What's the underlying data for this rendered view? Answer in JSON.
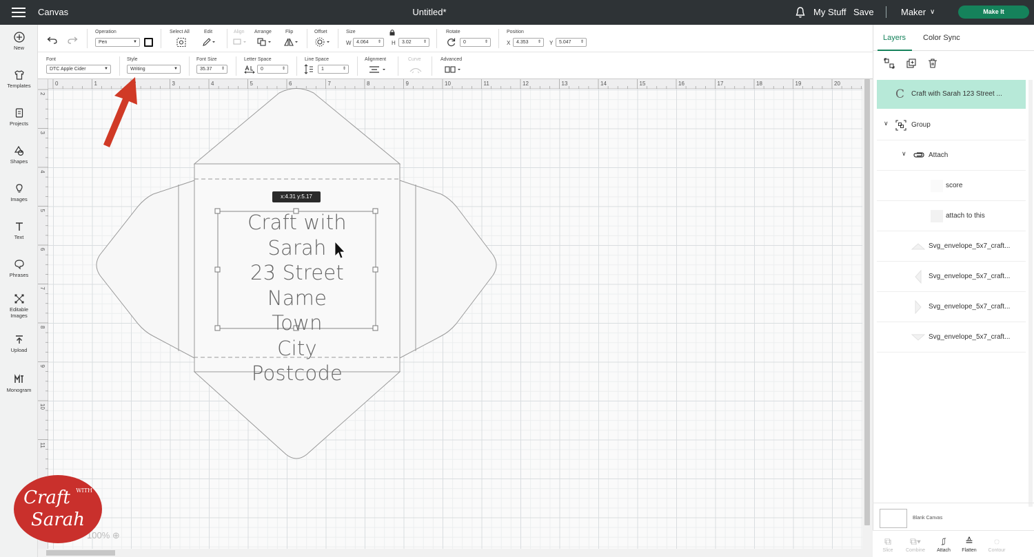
{
  "app": {
    "name": "Canvas",
    "doc_title": "Untitled*",
    "my_stuff": "My Stuff",
    "save": "Save",
    "machine": "Maker",
    "make_it": "Make It"
  },
  "sidebar": {
    "items": [
      {
        "label": "New",
        "icon": "plus-circle-icon"
      },
      {
        "label": "Templates",
        "icon": "shirt-icon"
      },
      {
        "label": "Projects",
        "icon": "projects-icon"
      },
      {
        "label": "Shapes",
        "icon": "shapes-icon"
      },
      {
        "label": "Images",
        "icon": "lightbulb-icon"
      },
      {
        "label": "Text",
        "icon": "text-T-icon"
      },
      {
        "label": "Phrases",
        "icon": "speech-bubble-icon"
      },
      {
        "label": "Editable",
        "label2": "Images",
        "icon": "editable-images-icon"
      },
      {
        "label": "Upload",
        "icon": "upload-icon"
      },
      {
        "label": "Monogram",
        "icon": "monogram-icon"
      }
    ]
  },
  "toolbar": {
    "operation_label": "Operation",
    "operation_value": "Pen",
    "select_all": "Select All",
    "edit": "Edit",
    "align": "Align",
    "arrange": "Arrange",
    "flip": "Flip",
    "offset": "Offset",
    "size_label": "Size",
    "w_label": "W",
    "w_value": "4.064",
    "h_label": "H",
    "h_value": "3.02",
    "rotate_label": "Rotate",
    "rotate_value": "0",
    "position_label": "Position",
    "x_label": "X",
    "x_value": "4.353",
    "y_label": "Y",
    "y_value": "5.047"
  },
  "texttoolbar": {
    "font_label": "Font",
    "font_value": "DTC Apple Cider",
    "style_label": "Style",
    "style_value": "Writing",
    "fontsize_label": "Font Size",
    "fontsize_value": "35.37",
    "letterspace_label": "Letter Space",
    "letterspace_value": "0",
    "linespace_label": "Line Space",
    "linespace_value": "1",
    "alignment_label": "Alignment",
    "curve_label": "Curve",
    "advanced_label": "Advanced"
  },
  "ruler": {
    "h": [
      "0",
      "1",
      "2",
      "3",
      "4",
      "5",
      "6",
      "7",
      "8",
      "9",
      "10",
      "11",
      "12",
      "13",
      "14",
      "15",
      "16",
      "17",
      "18",
      "19",
      "20"
    ],
    "v": [
      "2",
      "3",
      "4",
      "5",
      "6",
      "7",
      "8",
      "9",
      "10",
      "11"
    ]
  },
  "canvas": {
    "tooltip": "x:4.31 y:5.17",
    "text_lines": [
      "Craft with Sarah",
      "23 Street Name",
      "Town",
      "City",
      "Postcode"
    ],
    "zoom": "100%"
  },
  "layers": {
    "tab_layers": "Layers",
    "tab_colorsync": "Color Sync",
    "items": [
      {
        "label": "Craft with Sarah 123 Street ..."
      },
      {
        "label": "Group"
      },
      {
        "label": "Attach"
      },
      {
        "label": "score"
      },
      {
        "label": "attach to this"
      },
      {
        "label": "Svg_envelope_5x7_craft..."
      },
      {
        "label": "Svg_envelope_5x7_craft..."
      },
      {
        "label": "Svg_envelope_5x7_craft..."
      },
      {
        "label": "Svg_envelope_5x7_craft..."
      }
    ],
    "blank_canvas": "Blank Canvas",
    "bottom": [
      "Slice",
      "Combine",
      "Attach",
      "Flatten",
      "Contour"
    ]
  },
  "logo": {
    "line1": "Craft",
    "with": "WITH",
    "line2": "Sarah"
  },
  "colors": {
    "topbar": "#2e3336",
    "accent": "#15825b",
    "selected_layer": "#b7e9d8",
    "arrow": "#d03a26"
  }
}
